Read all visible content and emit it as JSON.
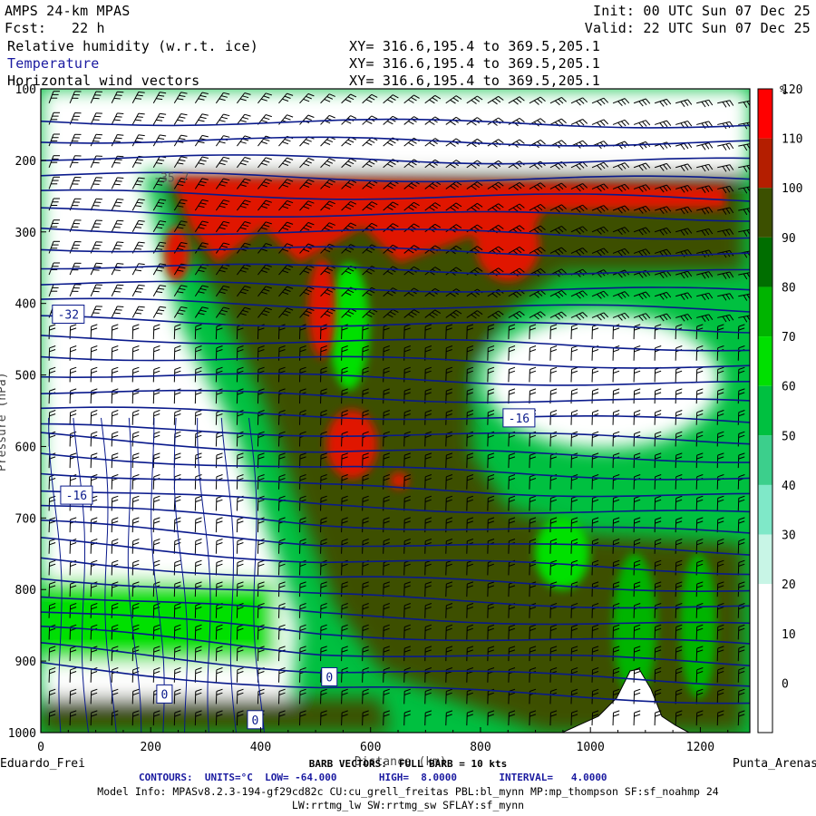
{
  "header": {
    "title_left": "AMPS 24-km MPAS",
    "forecast": "Fcst:   22 h",
    "init": "Init: 00 UTC Sun 07 Dec 25",
    "valid": "Valid: 22 UTC Sun 07 Dec 25",
    "fields": [
      {
        "name": "Relative humidity (w.r.t. ice)",
        "xy": "XY= 316.6,195.4 to 369.5,205.1"
      },
      {
        "name": "Temperature",
        "xy": "XY= 316.6,195.4 to 369.5,205.1"
      },
      {
        "name": "Horizontal wind vectors",
        "xy": "XY= 316.6,195.4 to 369.5,205.1"
      }
    ]
  },
  "chart_data": {
    "type": "heatmap",
    "x_ticks": [
      0,
      200,
      400,
      600,
      800,
      1000,
      1200
    ],
    "xlim": [
      0,
      1290
    ],
    "y_ticks": [
      100,
      200,
      300,
      400,
      500,
      600,
      700,
      800,
      900,
      1000
    ],
    "ylim": [
      100,
      1000
    ],
    "xlabel": "Distance (km)",
    "ylabel": "Pressure (hPa)",
    "left_endpoint": "Eduardo_Frei",
    "right_endpoint": "Punta_Arenas",
    "colorbar": {
      "unit": "%",
      "levels": [
        0,
        10,
        20,
        30,
        40,
        50,
        60,
        70,
        80,
        90,
        100,
        110,
        120
      ],
      "colors": [
        "#ffffff",
        "#ffffff",
        "#ffffff",
        "#c8f5e6",
        "#7fe8c8",
        "#3ccf8c",
        "#00c040",
        "#00e000",
        "#00b400",
        "#006e00",
        "#3c5000",
        "#b41e00",
        "#ff0000"
      ]
    },
    "temperature_contour_labels": [
      {
        "value": "-32",
        "x": 50,
        "p": 415
      },
      {
        "value": "-16",
        "x": 870,
        "p": 560
      },
      {
        "value": "-16",
        "x": 65,
        "p": 668
      },
      {
        "value": "0",
        "x": 225,
        "p": 946
      },
      {
        "value": "0",
        "x": 525,
        "p": 922
      },
      {
        "value": "0",
        "x": 390,
        "p": 982
      }
    ],
    "partial_label": "-35.7",
    "contours": {
      "units": "°C",
      "low": "-64.000",
      "high": "8.0000",
      "interval": "4.0000"
    },
    "barb_note": "BARB VECTORS:  FULL BARB = 10 kts"
  },
  "footer": {
    "contours_line": "CONTOURS:  UNITS=°C  LOW= -64.000       HIGH=  8.0000       INTERVAL=   4.0000",
    "model_info": "Model Info: MPASv8.2.3-194-gf29cd82c CU:cu_grell_freitas PBL:bl_mynn MP:mp_thompson SF:sf_noahmp 24",
    "model_info2": "LW:rrtmg_lw SW:rrtmg_sw SFLAY:sf_mynn"
  }
}
